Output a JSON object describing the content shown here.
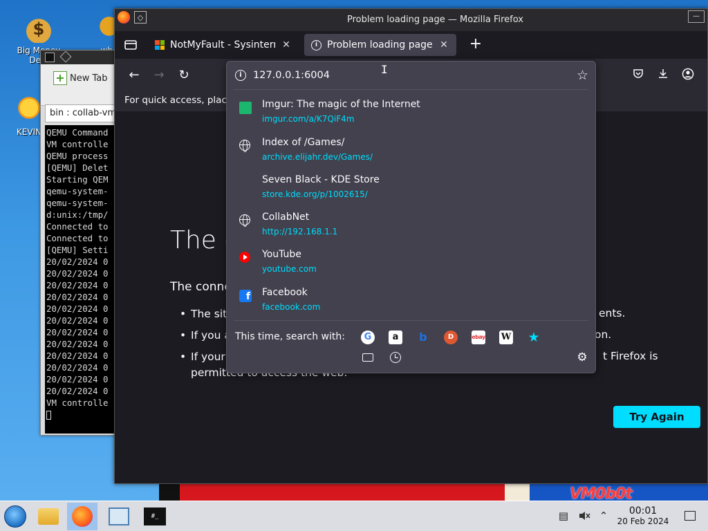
{
  "desktop": {
    "icons": [
      {
        "label": "Big Money Dela",
        "icon": "money-bag-icon"
      },
      {
        "label": "whe",
        "icon": "gear-icon"
      },
      {
        "label": "KEVIN",
        "icon": "sun-icon"
      }
    ],
    "wallpaper_text": "VM0b0t"
  },
  "terminal": {
    "new_tab_label": "New Tab",
    "path_value": "bin : collab-vm-s",
    "lines": [
      "QEMU Command",
      "VM controlle",
      "QEMU process",
      "[QEMU] Delet",
      "Starting QEM",
      "qemu-system-",
      "qemu-system-",
      "d:unix:/tmp/",
      "Connected to",
      "Connected to",
      "[QEMU] Setti",
      "20/02/2024 0",
      "20/02/2024 0",
      "20/02/2024 0",
      "20/02/2024 0",
      "20/02/2024 0",
      "20/02/2024 0",
      "20/02/2024 0",
      "20/02/2024 0",
      "20/02/2024 0",
      "20/02/2024 0",
      "20/02/2024 0",
      "20/02/2024 0",
      "VM controlle"
    ]
  },
  "firefox": {
    "window_title": "Problem loading page — Mozilla Firefox",
    "tabs": [
      {
        "label": "NotMyFault - Sysinternals",
        "icon": "microsoft-logo-icon"
      },
      {
        "label": "Problem loading page",
        "icon": "info-icon"
      }
    ],
    "bookmarks_bar_text": "For quick access, plac",
    "url": "127.0.0.1:6004",
    "suggestions": [
      {
        "title": "Imgur: The magic of the Internet",
        "url": "imgur.com/a/K7QiF4m",
        "icon": "imgur-icon"
      },
      {
        "title": "Index of /Games/",
        "url": "archive.elijahr.dev/Games/",
        "icon": "globe-icon"
      },
      {
        "title": "Seven Black - KDE Store",
        "url": "store.kde.org/p/1002615/",
        "icon": "kde-icon"
      },
      {
        "title": "CollabNet",
        "url": "http://192.168.1.1",
        "icon": "globe-icon"
      },
      {
        "title": "YouTube",
        "url": "youtube.com",
        "icon": "youtube-icon"
      },
      {
        "title": "Facebook",
        "url": "facebook.com",
        "icon": "facebook-icon"
      }
    ],
    "search_with_label": "This time, search with:",
    "search_engines": [
      "google",
      "amazon",
      "bing",
      "duckduckgo",
      "ebay",
      "wikipedia",
      "bookmarks",
      "tabs",
      "history",
      "settings"
    ],
    "error": {
      "title_fragment": "The c",
      "lead_fragment": "The conne",
      "bullets": [
        "The site",
        "If you a",
        "If your"
      ],
      "bullet3_line2": "permitted to access the web.",
      "right_fragments": [
        "ents.",
        "on.",
        "t Firefox is"
      ],
      "try_again_label": "Try Again"
    }
  },
  "taskbar": {
    "time": "00:01",
    "date": "20 Feb 2024"
  },
  "colors": {
    "accent": "#00ddff",
    "firefox_bg": "#1c1b22",
    "popup_bg": "#42414d"
  }
}
